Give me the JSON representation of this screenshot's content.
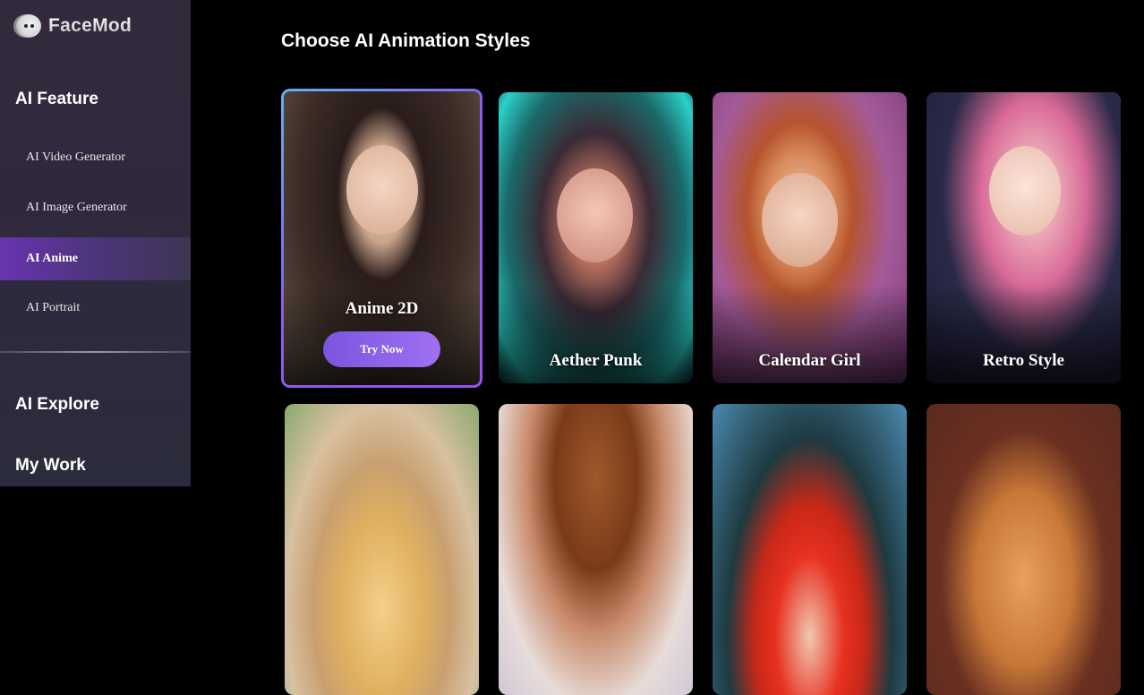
{
  "app": {
    "name": "FaceMod"
  },
  "sidebar": {
    "sections": [
      {
        "title": "AI Feature"
      },
      {
        "title": "AI Explore"
      },
      {
        "title": "My Work"
      }
    ],
    "items": [
      {
        "label": "AI Video Generator",
        "active": false
      },
      {
        "label": "AI Image Generator",
        "active": false
      },
      {
        "label": "AI Anime",
        "active": true
      },
      {
        "label": "AI Portrait",
        "active": false
      }
    ]
  },
  "main": {
    "title": "Choose AI Animation Styles",
    "styles": [
      {
        "label": "Anime 2D",
        "selected": true,
        "button": "Try Now"
      },
      {
        "label": "Aether Punk",
        "selected": false
      },
      {
        "label": "Calendar Girl",
        "selected": false
      },
      {
        "label": "Retro Style",
        "selected": false
      },
      {
        "label": "",
        "selected": false
      },
      {
        "label": "",
        "selected": false
      },
      {
        "label": "",
        "selected": false
      },
      {
        "label": "",
        "selected": false
      }
    ]
  }
}
